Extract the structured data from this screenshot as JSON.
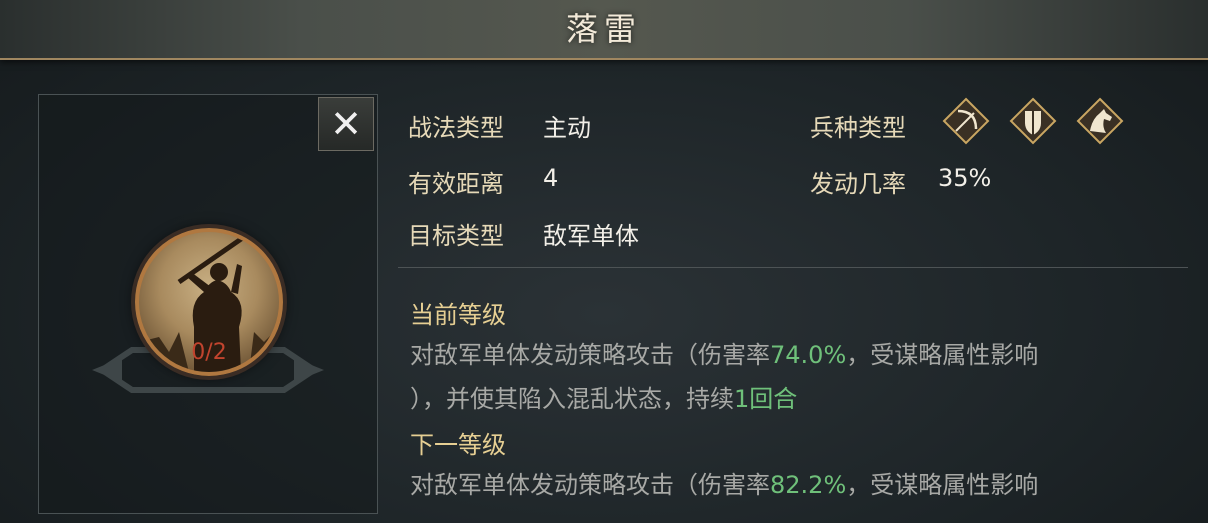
{
  "title": "落雷",
  "skill": {
    "level_text": "0/2"
  },
  "info": {
    "tactic_type_label": "战法类型",
    "tactic_type_value": "主动",
    "range_label": "有效距离",
    "range_value": "4",
    "target_label": "目标类型",
    "target_value": "敌军单体",
    "troop_label": "兵种类型",
    "trigger_label": "发动几率",
    "trigger_value": "35%",
    "troop_icons": [
      "bow-icon",
      "shield-icon",
      "horse-icon"
    ]
  },
  "current": {
    "heading": "当前等级",
    "line1_a": "对敌军单体发动策略攻击（伤害率",
    "line1_pct": "74.0%",
    "line1_b": "，受谋略属性影响",
    "line2_a": "），并使其陷入混乱状态，持续",
    "line2_hl": "1回合"
  },
  "next": {
    "heading": "下一等级",
    "line1_a": "对敌军单体发动策略攻击（伤害率",
    "line1_pct": "82.2%",
    "line1_b": "，受谋略属性影响"
  },
  "colors": {
    "accent_gold": "#a08760",
    "highlight_green": "#6fc07a",
    "level_red": "#c2442e"
  }
}
